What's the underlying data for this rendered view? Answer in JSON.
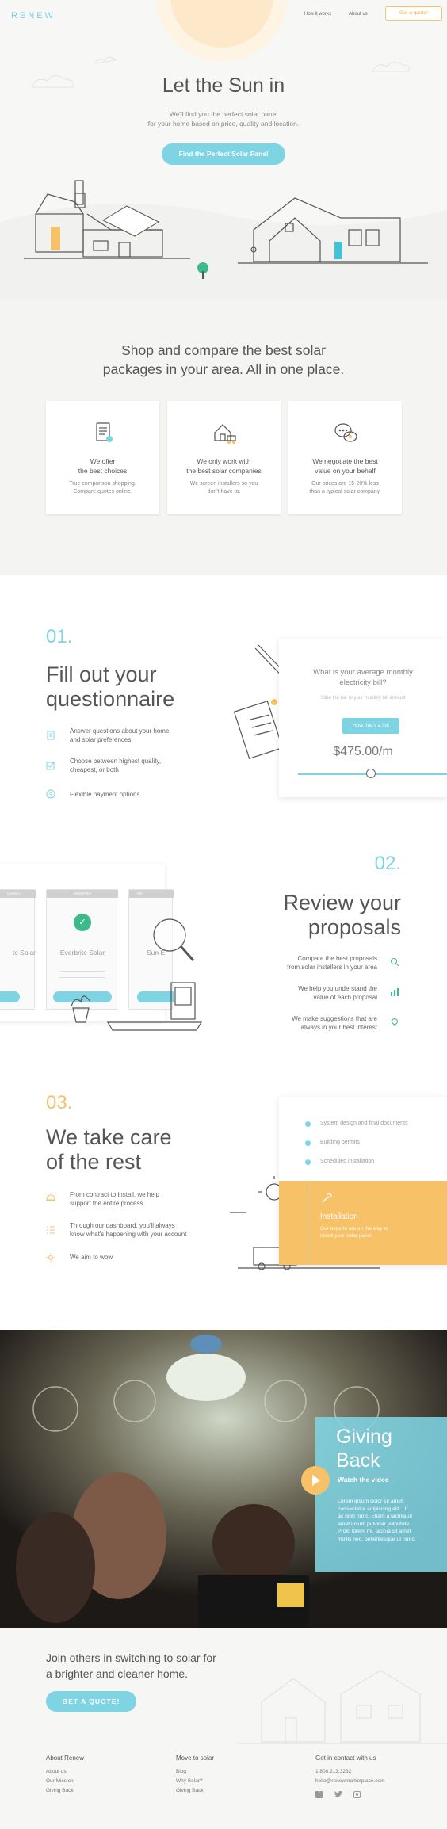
{
  "header": {
    "logo": "RENEW",
    "nav": [
      "How it works",
      "About us"
    ],
    "quote_button": "Get a quote!"
  },
  "hero": {
    "title": "Let the Sun in",
    "subtitle_line1": "We'll find you the perfect solar panel",
    "subtitle_line2": "for your home based on price, quality and location.",
    "cta": "Find the Perfect Solar Panel"
  },
  "features": {
    "title_line1": "Shop and compare the best solar",
    "title_line2": "packages in your area. All in one place.",
    "cards": [
      {
        "icon": "document-icon",
        "heading_line1": "We offer",
        "heading_line2": "the best choices",
        "desc_line1": "True comparison shopping.",
        "desc_line2": "Compare quotes online."
      },
      {
        "icon": "house-truck-icon",
        "heading_line1": "We only work with",
        "heading_line2": "the best solar companies",
        "desc_line1": "We screen installers so you",
        "desc_line2": "don't have to."
      },
      {
        "icon": "chat-bubbles-icon",
        "heading_line1": "We negotiate the best",
        "heading_line2": "value on your behalf",
        "desc_line1": "Our prices are 15-20% less",
        "desc_line2": "than a typical solar company."
      }
    ]
  },
  "step1": {
    "number": "01.",
    "title_line1": "Fill out your",
    "title_line2": "questionnaire",
    "items": [
      {
        "icon": "document-icon",
        "line1": "Answer questions about your home",
        "line2": "and solar preferences"
      },
      {
        "icon": "checkbox-icon",
        "line1": "Choose between highest quality,",
        "line2": "cheapest, or both"
      },
      {
        "icon": "dollar-icon",
        "line1": "Flexible payment options",
        "line2": ""
      }
    ],
    "panel": {
      "question_line1": "What is your average monthly",
      "question_line2": "electricity bill?",
      "hint": "Slide the bar to your monthly bill amount",
      "button": "How that's a lot!",
      "amount": "$475.00/m"
    }
  },
  "step2": {
    "number": "02.",
    "title_line1": "Review your",
    "title_line2": "proposals",
    "items": [
      {
        "icon": "search-icon",
        "line1": "Compare the best proposals",
        "line2": "from solar installers in your area"
      },
      {
        "icon": "bar-chart-icon",
        "line1": "We help you understand the",
        "line2": "value of each proposal"
      },
      {
        "icon": "lightbulb-icon",
        "line1": "We make suggestions that are",
        "line2": "always in your best interest"
      }
    ],
    "proposals": [
      {
        "tag": "Design",
        "name": "te Solar"
      },
      {
        "tag": "Best Price",
        "name": "Everbrite Solar"
      },
      {
        "tag": "Qu",
        "name": "Sun E"
      }
    ]
  },
  "step3": {
    "number": "03.",
    "title_line1": "We take care",
    "title_line2": "of the rest",
    "items": [
      {
        "icon": "helmet-icon",
        "line1": "From contract to install, we help",
        "line2": "support the entire process"
      },
      {
        "icon": "list-icon",
        "line1": "Through our dashboard, you'll always",
        "line2": "know what's happening with your account"
      },
      {
        "icon": "sun-icon",
        "line1": "We aim to wow",
        "line2": ""
      }
    ],
    "timeline": [
      "System design and final documents",
      "Building permits",
      "Scheduled installation"
    ],
    "active": {
      "title": "Installation",
      "line1": "Our experts are on the way to",
      "line2": "install your solar panel"
    }
  },
  "giving": {
    "title_line1": "Giving",
    "title_line2": "Back",
    "video_label": "Watch the video",
    "body": [
      "Lorem ipsum dolor sit amet,",
      "consectetur adipiscing elit. Ut",
      "ac nibh nunc. Etiam a lacinia ut",
      "amet ipsum pulvinar vulputate.",
      "Proin lorem mi, lacinia sit amet",
      "mollis nec, pellentesque ut nunc."
    ]
  },
  "footer": {
    "cta_line1": "Join others in switching to solar for",
    "cta_line2": "a brighter and cleaner home.",
    "cta_button": "GET A QUOTE!",
    "columns": [
      {
        "heading": "About Renew",
        "links": [
          "About us",
          "Our Mission",
          "Giving Back"
        ]
      },
      {
        "heading": "Move to solar",
        "links": [
          "Blog",
          "Why Solar?",
          "Giving Back"
        ]
      },
      {
        "heading": "Get in contact with us",
        "links": [
          "1.800.213.3232",
          "hello@renewmarketplace.com"
        ]
      }
    ],
    "social": [
      "facebook-icon",
      "twitter-icon",
      "instagram-icon"
    ]
  },
  "colors": {
    "teal": "#7fd4e4",
    "yellow": "#f7c267",
    "text": "#555555"
  }
}
